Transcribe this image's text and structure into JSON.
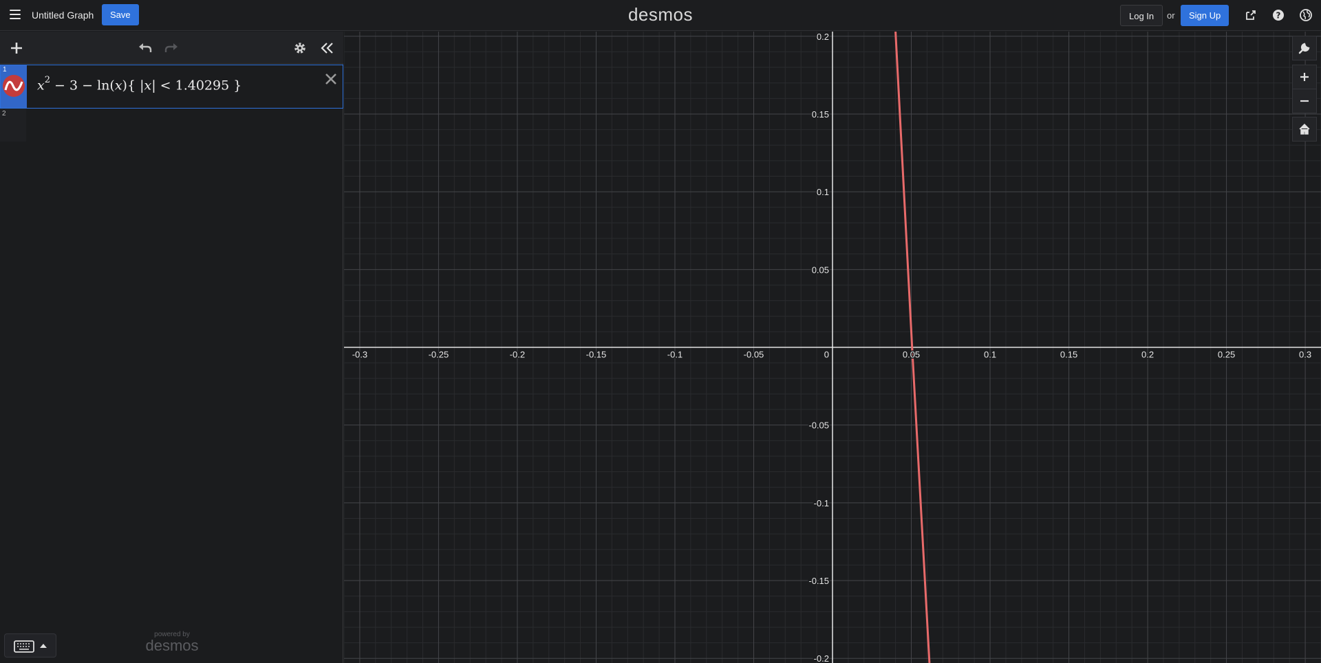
{
  "header": {
    "title": "Untitled Graph",
    "save_label": "Save",
    "logo": "desmos",
    "login_label": "Log In",
    "or_label": "or",
    "signup_label": "Sign Up"
  },
  "expressions": [
    {
      "index": "1",
      "latex_parts": {
        "var1": "x",
        "exp": "2",
        "rest1": " − 3 − ln(",
        "var2": "x",
        "rest2": "){ |",
        "var3": "x",
        "rest3": "| < 1.40295 }"
      },
      "color": "#c74440"
    },
    {
      "index": "2"
    }
  ],
  "footer": {
    "powered_by": "powered by",
    "powered_logo": "desmos"
  },
  "graph": {
    "x_ticks": [
      "-0.3",
      "-0.25",
      "-0.2",
      "-0.15",
      "-0.1",
      "-0.05",
      "0",
      "0.05",
      "0.1",
      "0.15",
      "0.2",
      "0.25",
      "0.3"
    ],
    "y_ticks": [
      "0.2",
      "0.15",
      "0.1",
      "0.05",
      "-0.05",
      "-0.1",
      "-0.15",
      "-0.2"
    ],
    "xlim": [
      -0.31,
      0.31
    ],
    "ylim": [
      -0.203,
      0.203
    ],
    "curve_color": "#e86a6a",
    "curve_points": [
      [
        0.04,
        0.203
      ],
      [
        0.0505,
        0.0
      ],
      [
        0.0615,
        -0.203
      ]
    ]
  },
  "colors": {
    "accent": "#2f72dc",
    "grid_minor": "#2a2b2e",
    "grid_major": "#45464a",
    "axis": "#e8e8e8"
  }
}
